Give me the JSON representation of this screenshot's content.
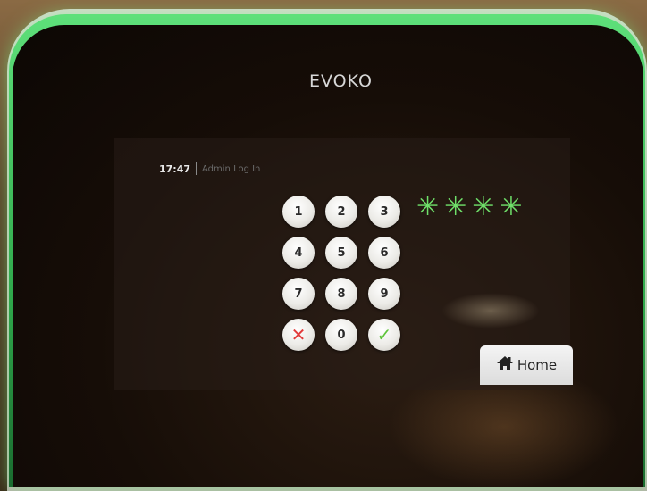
{
  "device": {
    "brand": "EVOKO"
  },
  "topbar": {
    "time": "17:47",
    "title": "Admin Log In"
  },
  "keypad": {
    "keys": [
      "1",
      "2",
      "3",
      "4",
      "5",
      "6",
      "7",
      "8",
      "9",
      "✕",
      "0",
      "✓"
    ]
  },
  "pin": {
    "masked": [
      "✳",
      "✳",
      "✳",
      "✳"
    ]
  },
  "home": {
    "label": "Home"
  },
  "colors": {
    "accent_green": "#6fe06a",
    "cancel_red": "#e23a3a",
    "confirm_green": "#5ec43a"
  }
}
